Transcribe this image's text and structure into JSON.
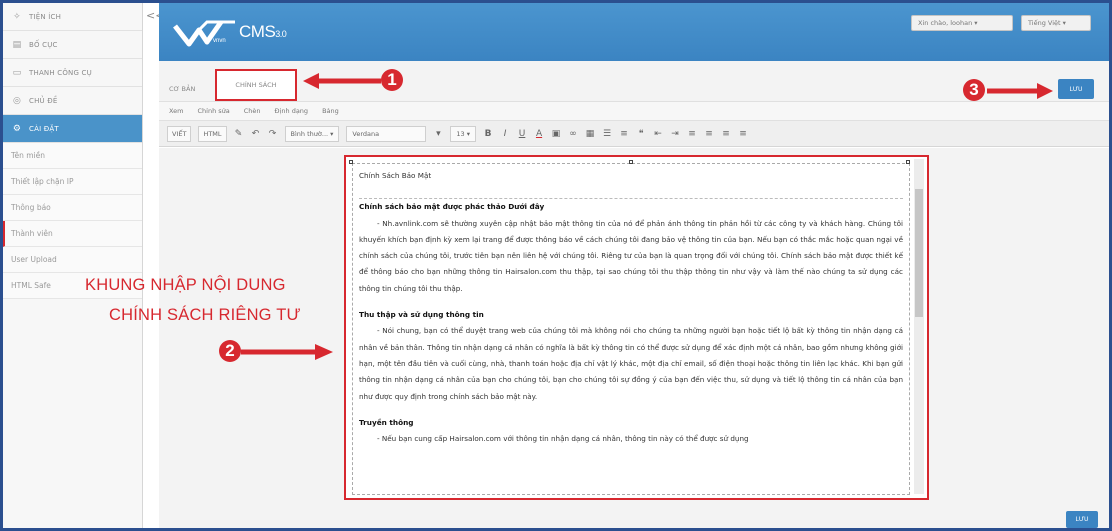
{
  "sidebar": {
    "items": [
      {
        "label": "TIỆN ÍCH",
        "icon": "puzzle-icon"
      },
      {
        "label": "BỐ CỤC",
        "icon": "layout-icon"
      },
      {
        "label": "THANH CÔNG CỤ",
        "icon": "toolbar-icon"
      },
      {
        "label": "CHỦ ĐỀ",
        "icon": "theme-icon"
      },
      {
        "label": "CÀI ĐẶT",
        "icon": "gear-icon",
        "active": true
      }
    ],
    "subitems": [
      {
        "label": "Tên miền"
      },
      {
        "label": "Thiết lập chặn IP"
      },
      {
        "label": "Thông báo"
      },
      {
        "label": "Thành viên",
        "current": true
      },
      {
        "label": "User Upload"
      },
      {
        "label": "HTML Safe"
      }
    ],
    "collapse": "<<"
  },
  "header": {
    "logo_vn": "vnvn",
    "logo_cms": "CMS",
    "logo_version": "3.0",
    "greeting": "Xin chào, loohan ▾",
    "language": "Tiếng Việt ▾"
  },
  "tabs": {
    "basic": "CƠ BẢN",
    "policy": "CHÍNH SÁCH"
  },
  "save_label": "LƯU",
  "menubar": [
    "Xem",
    "Chỉnh sửa",
    "Chèn",
    "Định dạng",
    "Bảng"
  ],
  "toolbar": {
    "view": "VIẾT",
    "html": "HTML",
    "format": "Bình thườ... ▾",
    "font": "Verdana",
    "size": "13"
  },
  "editor": {
    "title": "Chính Sách Bảo Mật",
    "h1": "Chính sách bảo mật được phác thảo Dưới đây",
    "p1": "- Nh.avnlink.com sẽ thường xuyên cập nhật bảo mật thông tin của nó để phản ánh thông tin phản hồi từ các công ty và khách hàng. Chúng tôi khuyến khích bạn định kỳ xem lại trang để được thông báo về cách chúng tôi đang bảo vệ thông tin của bạn. Nếu bạn có thắc mắc hoặc quan ngại về chính sách của chúng tôi, trước tiên bạn nên liên hệ với chúng tôi. Riêng tư của bạn là quan trọng đối với chúng tôi. Chính sách bảo mật được thiết kế để thông báo cho bạn những thông tin Hairsalon.com thu thập, tại sao chúng tôi thu thập thông tin như vậy và làm thế nào chúng ta sử dụng các thông tin chúng tôi thu thập.",
    "h2": "Thu thập và sử dụng thông tin",
    "p2": "- Nói chung, bạn có thể duyệt trang web của chúng tôi mà không nói cho chúng ta những người bạn hoặc tiết lộ bất kỳ thông tin nhận dạng cá nhân về bản thân. Thông tin nhận dạng cá nhân có nghĩa là bất kỳ thông tin có thể được sử dụng để xác định một cá nhân, bao gồm nhưng không giới hạn, một tên đầu tiên và cuối cùng, nhà, thanh toán hoặc địa chỉ vật lý khác, một địa chỉ email, số điện thoại hoặc thông tin liên lạc khác. Khi bạn gửi thông tin nhận dạng cá nhân của bạn cho chúng tôi, bạn cho chúng tôi sự đồng ý của bạn đến việc thu, sử dụng và tiết lộ thông tin cá nhân của bạn như được quy định trong chính sách bảo mật này.",
    "h3": "Truyền thông",
    "p3": "- Nếu bạn cung cấp Hairsalon.com với thông tin nhận dạng cá nhân, thông tin này có thể được sử dụng"
  },
  "annotations": {
    "label_line1": "KHUNG NHẬP NỘI DUNG",
    "label_line2": "CHÍNH SÁCH RIÊNG TƯ",
    "n1": "1",
    "n2": "2",
    "n3": "3",
    "color": "#d7282f"
  },
  "colors": {
    "accent": "#3b84c2",
    "annotation": "#d7282f"
  }
}
